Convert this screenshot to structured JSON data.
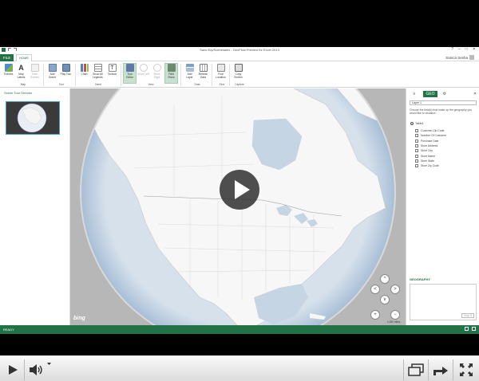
{
  "titlebar": {
    "title": "Sand EqvScenesalex - GeoFlow Preview for Excel 2013",
    "window_controls": [
      "?",
      "–",
      "□",
      "✕"
    ]
  },
  "tabs": {
    "file": "FILE",
    "home": "HOME"
  },
  "user": "Sanica Sesha",
  "ribbon": {
    "buttons": [
      {
        "label": "Themes",
        "icon": "themes-icon"
      },
      {
        "label": "Map Labels",
        "icon": "map-labels-icon"
      },
      {
        "label": "Data Scenes",
        "icon": "data-scenes-icon"
      },
      {
        "label": "Add Scene",
        "icon": "add-scene-icon"
      },
      {
        "label": "Play Tour",
        "icon": "play-tour-icon"
      },
      {
        "label": "Chart",
        "icon": "chart-icon"
      },
      {
        "label": "Show All Legends",
        "icon": "legends-icon"
      },
      {
        "label": "Textbox",
        "icon": "textbox-icon"
      },
      {
        "label": "Tour Editor",
        "icon": "tour-editor-icon"
      },
      {
        "label": "Move Left",
        "icon": "move-left-icon"
      },
      {
        "label": "Move Right",
        "icon": "move-right-icon"
      },
      {
        "label": "Field Show",
        "icon": "field-show-icon"
      },
      {
        "label": "Add Layer",
        "icon": "add-layer-icon"
      },
      {
        "label": "Refresh Data",
        "icon": "refresh-data-icon"
      },
      {
        "label": "Find Location",
        "icon": "find-location-icon"
      },
      {
        "label": "Copy Screen",
        "icon": "copy-screen-icon"
      }
    ],
    "groups": [
      "Map",
      "Tour",
      "Insert",
      "View",
      "Data",
      "Find",
      "Capture"
    ]
  },
  "left_panel": {
    "header": "Scene Tour Director"
  },
  "map": {
    "bing": "bing",
    "scale": "1,000 miles",
    "nav": {
      "up": "^",
      "down": "v",
      "left": "<",
      "right": ">",
      "zoom_in": "+",
      "zoom_out": "−"
    }
  },
  "right_pane": {
    "tabs": {
      "layers": "≡",
      "geo": "GEO",
      "settings": "⚙",
      "close": "✕"
    },
    "layer": "Layer 1",
    "instructions": "Choose the field(s) that make up the geography you would like to visualize.",
    "table": "Table1",
    "fields": [
      "Customer Zip Code",
      "Number Of Customer",
      "Purchase Date",
      "Store Address",
      "Store City",
      "Store Name",
      "Store State",
      "Store Zip Code"
    ],
    "geography_title": "GEOGRAPHY",
    "next_label": "Map It"
  },
  "status": {
    "text": "READY"
  },
  "video": {
    "progress": 0.02,
    "progress_color": "#cc2222",
    "accent": "#217346"
  }
}
